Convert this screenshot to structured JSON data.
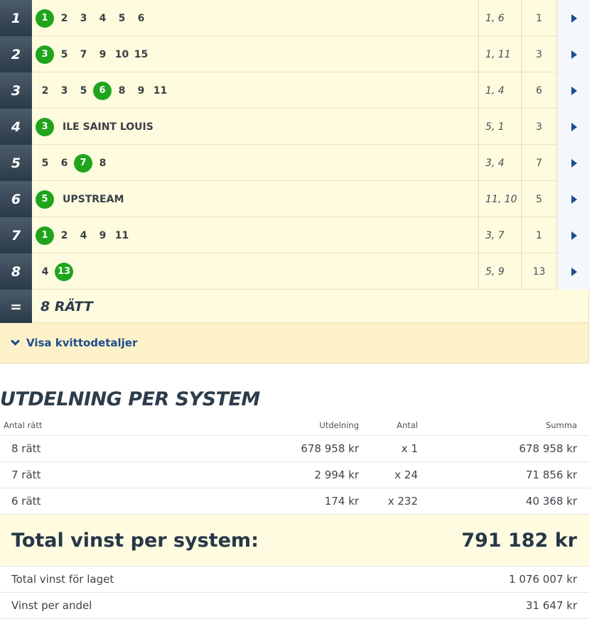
{
  "races": [
    {
      "leg": "1",
      "horses": [
        "1",
        "2",
        "3",
        "4",
        "5",
        "6"
      ],
      "winner_index": 0,
      "horse_name": "",
      "order": "1, 6",
      "winner": "1"
    },
    {
      "leg": "2",
      "horses": [
        "3",
        "5",
        "7",
        "9",
        "10",
        "15"
      ],
      "winner_index": 0,
      "horse_name": "",
      "order": "1, 11",
      "winner": "3"
    },
    {
      "leg": "3",
      "horses": [
        "2",
        "3",
        "5",
        "6",
        "8",
        "9",
        "11"
      ],
      "winner_index": 3,
      "horse_name": "",
      "order": "1, 4",
      "winner": "6"
    },
    {
      "leg": "4",
      "horses": [
        "3"
      ],
      "winner_index": 0,
      "horse_name": "ILE SAINT LOUIS",
      "order": "5, 1",
      "winner": "3"
    },
    {
      "leg": "5",
      "horses": [
        "5",
        "6",
        "7",
        "8"
      ],
      "winner_index": 2,
      "horse_name": "",
      "order": "3, 4",
      "winner": "7"
    },
    {
      "leg": "6",
      "horses": [
        "5"
      ],
      "winner_index": 0,
      "horse_name": "UPSTREAM",
      "order": "11, 10",
      "winner": "5"
    },
    {
      "leg": "7",
      "horses": [
        "1",
        "2",
        "4",
        "9",
        "11"
      ],
      "winner_index": 0,
      "horse_name": "",
      "order": "3, 7",
      "winner": "1"
    },
    {
      "leg": "8",
      "horses": [
        "4",
        "13"
      ],
      "winner_index": 1,
      "horse_name": "",
      "order": "5, 9",
      "winner": "13"
    }
  ],
  "total": {
    "symbol": "=",
    "label": "8 RÄTT"
  },
  "receipt_toggle": "Visa kvittodetaljer",
  "section_title": "UTDELNING PER SYSTEM",
  "payout_table": {
    "headers": [
      "Antal rätt",
      "Utdelning",
      "Antal",
      "Summa"
    ],
    "rows": [
      {
        "rights": "8 rätt",
        "payout": "678 958 kr",
        "count": "x 1",
        "sum": "678 958 kr"
      },
      {
        "rights": "7 rätt",
        "payout": "2 994 kr",
        "count": "x 24",
        "sum": "71 856 kr"
      },
      {
        "rights": "6 rätt",
        "payout": "174 kr",
        "count": "x 232",
        "sum": "40 368 kr"
      }
    ]
  },
  "grand_total": {
    "label": "Total vinst per system:",
    "value": "791 182 kr"
  },
  "summary": [
    {
      "label": "Total vinst för laget",
      "value": "1 076 007 kr"
    },
    {
      "label": "Vinst per andel",
      "value": "31 647 kr"
    }
  ],
  "colors": {
    "winner_green": "#1fa51c",
    "leg_badge": "#2b3a48",
    "row_bg": "#fefbdf",
    "link_blue": "#1d4d8e"
  }
}
